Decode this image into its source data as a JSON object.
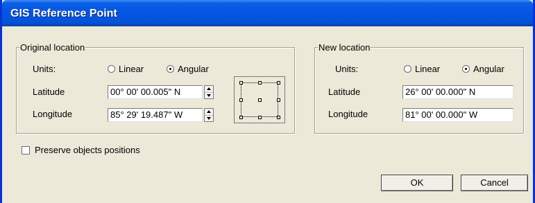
{
  "window": {
    "title": "GIS Reference Point"
  },
  "original": {
    "legend": "Original location",
    "units_label": "Units:",
    "units_options": [
      "Linear",
      "Angular"
    ],
    "units_selected": "Angular",
    "latitude_label": "Latitude",
    "latitude_value": "00° 00' 00.005\" N",
    "longitude_label": "Longitude",
    "longitude_value": "85° 29' 19.487\" W"
  },
  "new": {
    "legend": "New location",
    "units_label": "Units:",
    "units_options": [
      "Linear",
      "Angular"
    ],
    "units_selected": "Angular",
    "latitude_label": "Latitude",
    "latitude_value": "26° 00' 00.000\" N",
    "longitude_label": "Longitude",
    "longitude_value": "81° 00' 00.000\" W"
  },
  "preserve_label": "Preserve objects positions",
  "preserve_checked": false,
  "buttons": {
    "ok": "OK",
    "cancel": "Cancel"
  },
  "colors": {
    "title_bar": "#0554e3",
    "frame": "#0831d9",
    "dialog_bg": "#ece9d8"
  }
}
